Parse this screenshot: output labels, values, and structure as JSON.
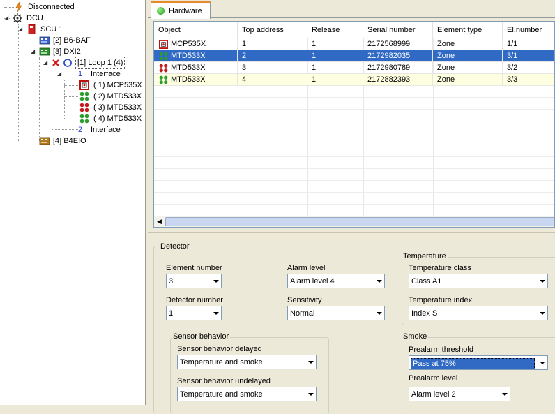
{
  "tree": {
    "items": [
      {
        "label": "Disconnected"
      },
      {
        "label": "DCU"
      },
      {
        "label": "SCU 1"
      },
      {
        "label": "[2] B6-BAF"
      },
      {
        "label": "[3] DXI2"
      },
      {
        "label": "[1] Loop 1 (4)"
      },
      {
        "label": "Interface",
        "num": "1"
      },
      {
        "label": "( 1) MCP535X"
      },
      {
        "label": "( 2) MTD533X"
      },
      {
        "label": "( 3) MTD533X"
      },
      {
        "label": "( 4) MTD533X"
      },
      {
        "label": "Interface",
        "num": "2"
      },
      {
        "label": "[4] B4EIO"
      }
    ]
  },
  "tab": {
    "label": "Hardware"
  },
  "grid": {
    "columns": [
      "Object",
      "Top address",
      "Release",
      "Serial number",
      "Element type",
      "El.number"
    ],
    "rows": [
      [
        "MCP535X",
        "1",
        "1",
        "2172568999",
        "Zone",
        "1/1"
      ],
      [
        "MTD533X",
        "2",
        "1",
        "2172982035",
        "Zone",
        "3/1"
      ],
      [
        "MTD533X",
        "3",
        "1",
        "2172980789",
        "Zone",
        "3/2"
      ],
      [
        "MTD533X",
        "4",
        "1",
        "2172882393",
        "Zone",
        "3/3"
      ]
    ]
  },
  "detector": {
    "title": "Detector",
    "element_number": {
      "label": "Element number",
      "value": "3"
    },
    "detector_number": {
      "label": "Detector number",
      "value": "1"
    },
    "alarm_level": {
      "label": "Alarm level",
      "value": "Alarm level 4"
    },
    "sensitivity": {
      "label": "Sensitivity",
      "value": "Normal"
    },
    "sensor_behavior": {
      "title": "Sensor behavior",
      "delayed": {
        "label": "Sensor behavior delayed",
        "value": "Temperature and smoke"
      },
      "undelayed": {
        "label": "Sensor behavior undelayed",
        "value": "Temperature and smoke"
      }
    }
  },
  "temperature": {
    "title": "Temperature",
    "class": {
      "label": "Temperature class",
      "value": "Class A1"
    },
    "index": {
      "label": "Temperature index",
      "value": "Index S"
    }
  },
  "smoke": {
    "title": "Smoke",
    "prealarm_threshold": {
      "label": "Prealarm threshold",
      "value": "Pass at 75%"
    },
    "prealarm_level": {
      "label": "Prealarm level",
      "value": "Alarm level 2"
    }
  },
  "colors": {
    "selection": "#316ac5",
    "tab_accent": "#e68b2c",
    "highlight_row": "#fefee1"
  }
}
